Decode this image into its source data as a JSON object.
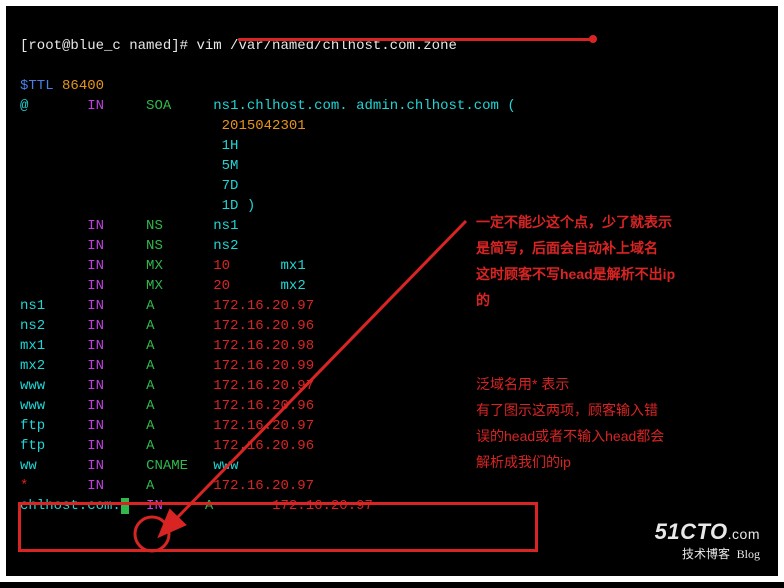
{
  "prompt": {
    "prefix": "[root@blue_c named]# ",
    "command": "vim /var/named/chlhost.com.zone"
  },
  "zone": {
    "ttl_label": "$TTL",
    "ttl_value": "86400",
    "origin": "@",
    "col_in": "IN",
    "soa_type": "SOA",
    "soa_mname": "ns1.chlhost.com.",
    "soa_rname": "admin.chlhost.com (",
    "serial": "2015042301",
    "refresh": "1H",
    "retry": "5M",
    "expire": "7D",
    "minimum": "1D )",
    "records": [
      {
        "name": "",
        "type": "NS",
        "rdata": "ns1",
        "extra": ""
      },
      {
        "name": "",
        "type": "NS",
        "rdata": "ns2",
        "extra": ""
      },
      {
        "name": "",
        "type": "MX",
        "rdata": "10",
        "extra": "mx1"
      },
      {
        "name": "",
        "type": "MX",
        "rdata": "20",
        "extra": "mx2"
      },
      {
        "name": "ns1",
        "type": "A",
        "rdata": "172.16.20.97",
        "extra": ""
      },
      {
        "name": "ns2",
        "type": "A",
        "rdata": "172.16.20.96",
        "extra": ""
      },
      {
        "name": "mx1",
        "type": "A",
        "rdata": "172.16.20.98",
        "extra": ""
      },
      {
        "name": "mx2",
        "type": "A",
        "rdata": "172.16.20.99",
        "extra": ""
      },
      {
        "name": "www",
        "type": "A",
        "rdata": "172.16.20.97",
        "extra": ""
      },
      {
        "name": "www",
        "type": "A",
        "rdata": "172.16.20.96",
        "extra": ""
      },
      {
        "name": "ftp",
        "type": "A",
        "rdata": "172.16.20.97",
        "extra": ""
      },
      {
        "name": "ftp",
        "type": "A",
        "rdata": "172.16.20.96",
        "extra": ""
      },
      {
        "name": "ww",
        "type": "CNAME",
        "rdata": "www",
        "extra": ""
      },
      {
        "name": "*",
        "type": "A",
        "rdata": "172.16.20.97",
        "extra": ""
      },
      {
        "name": "chlhost.com.",
        "cursor": true,
        "type": "A",
        "rdata": "172.16.20.97",
        "extra": "",
        "indent2": true
      }
    ]
  },
  "annot_bold_lines": [
    "一定不能少这个点，少了就表示",
    "是简写，后面会自动补上域名",
    "这时顾客不写head是解析不出ip",
    "的"
  ],
  "annot_thin_lines": [
    "泛域名用* 表示",
    "有了图示这两项，顾客输入错",
    "误的head或者不输入head都会",
    "解析成我们的ip"
  ],
  "watermark": {
    "brand": "51CTO",
    "suffix": ".com",
    "tagline": "技术博客",
    "blog": "Blog"
  }
}
